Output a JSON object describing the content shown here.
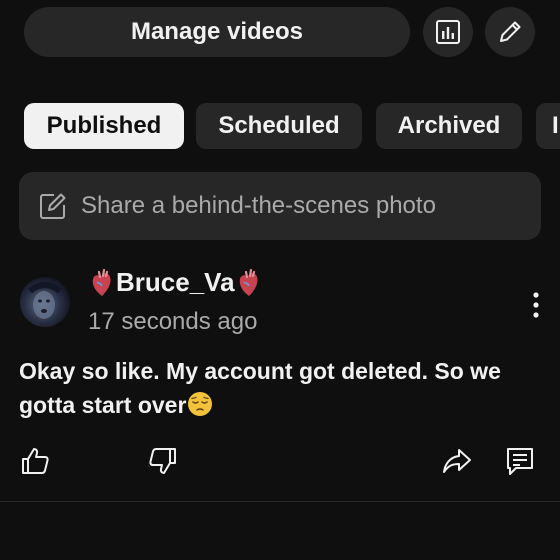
{
  "header": {
    "manage_videos_label": "Manage videos",
    "analytics_icon": "analytics-icon",
    "edit_icon": "pencil-icon"
  },
  "tabs": [
    {
      "label": "Published",
      "active": true
    },
    {
      "label": "Scheduled",
      "active": false
    },
    {
      "label": "Archived",
      "active": false
    },
    {
      "label": "I",
      "active": false
    }
  ],
  "composer": {
    "icon": "edit-square-icon",
    "placeholder": "Share a behind-the-scenes photo"
  },
  "post": {
    "author": "Bruce_Va",
    "author_decoration": "anatomical-heart-emoji",
    "time": "17 seconds ago",
    "text": "Okay so like. My account got deleted. So we gotta start over",
    "text_emoji": "pensive-face-emoji",
    "actions": [
      "like-icon",
      "dislike-icon",
      "share-icon",
      "comment-icon"
    ]
  },
  "colors": {
    "background": "#0f0f0f",
    "surface": "#272727",
    "text_primary": "#f1f1f1",
    "text_secondary": "#aaaaaa",
    "chip_active_bg": "#f1f1f1"
  }
}
